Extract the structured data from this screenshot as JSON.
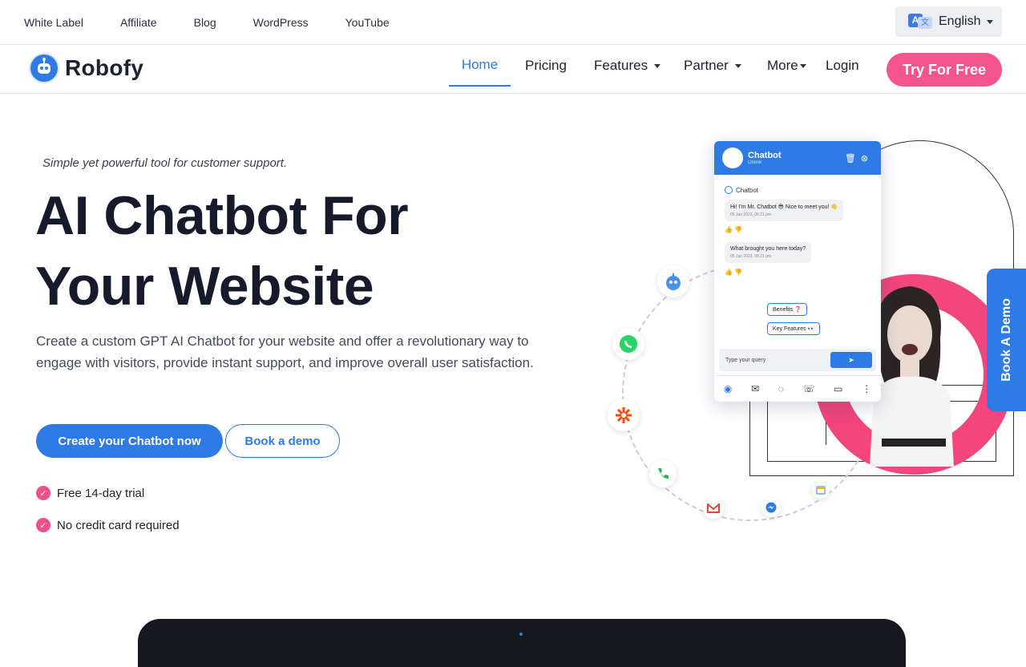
{
  "topbar": {
    "links": [
      "White Label",
      "Affiliate",
      "Blog",
      "WordPress",
      "YouTube"
    ],
    "language": "English"
  },
  "navbar": {
    "brand": "Robofy",
    "menu": {
      "home": "Home",
      "pricing": "Pricing",
      "features": "Features",
      "partner": "Partner",
      "more": "More",
      "login": "Login"
    },
    "cta": "Try For Free"
  },
  "hero": {
    "tagline": "Simple yet powerful tool for customer support.",
    "title_line1": "AI Chatbot For",
    "title_line2": "Your Website",
    "description": "Create a custom GPT AI Chatbot for your website and offer a revolutionary way to engage with visitors, provide instant support, and improve overall user satisfaction.",
    "primary_button": "Create your Chatbot now",
    "secondary_button": "Book a demo",
    "checks": [
      "Free 14-day trial",
      "No credit card required"
    ]
  },
  "widget": {
    "title": "Chatbot",
    "status": "Online",
    "sender": "Chatbot",
    "messages": [
      {
        "text": "Hi! I'm Mr. Chatbot 😎 Nice to meet you! 👋",
        "time": "05 Jun 2023, 06:21 pm"
      },
      {
        "text": "What brought you here today?",
        "time": "05 Jun 2023, 06:21 pm"
      }
    ],
    "chips": [
      "Benefits ❓",
      "Key Features 👀"
    ],
    "input_placeholder": "Type your query"
  },
  "book_demo_tab": "Book A Demo",
  "colors": {
    "primary": "#2f7be6",
    "accent": "#f5558c"
  }
}
